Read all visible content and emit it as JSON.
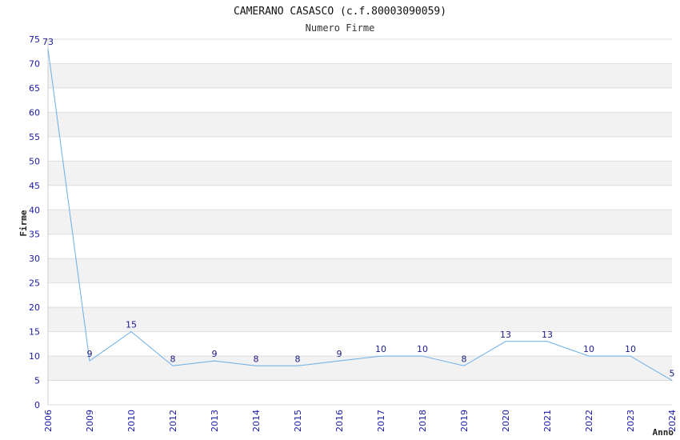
{
  "chart_data": {
    "type": "line",
    "title": "CAMERANO CASASCO (c.f.80003090059)",
    "subtitle": "Numero Firme",
    "xlabel": "Anno",
    "ylabel": "Firme",
    "categories": [
      "2006",
      "2009",
      "2010",
      "2012",
      "2013",
      "2014",
      "2015",
      "2016",
      "2017",
      "2018",
      "2019",
      "2020",
      "2021",
      "2022",
      "2023",
      "2024"
    ],
    "values": [
      73,
      9,
      15,
      8,
      9,
      8,
      8,
      9,
      10,
      10,
      8,
      13,
      13,
      10,
      10,
      5
    ],
    "ylim": [
      0,
      75
    ],
    "yticks": [
      0,
      5,
      10,
      15,
      20,
      25,
      30,
      35,
      40,
      45,
      50,
      55,
      60,
      65,
      70,
      75
    ],
    "grid": true,
    "colors": {
      "line": "#6aaee8",
      "band": "#f2f2f2",
      "grid": "#dddddd",
      "tick": "#1a1aa6",
      "label": "#1a1a8a"
    }
  }
}
